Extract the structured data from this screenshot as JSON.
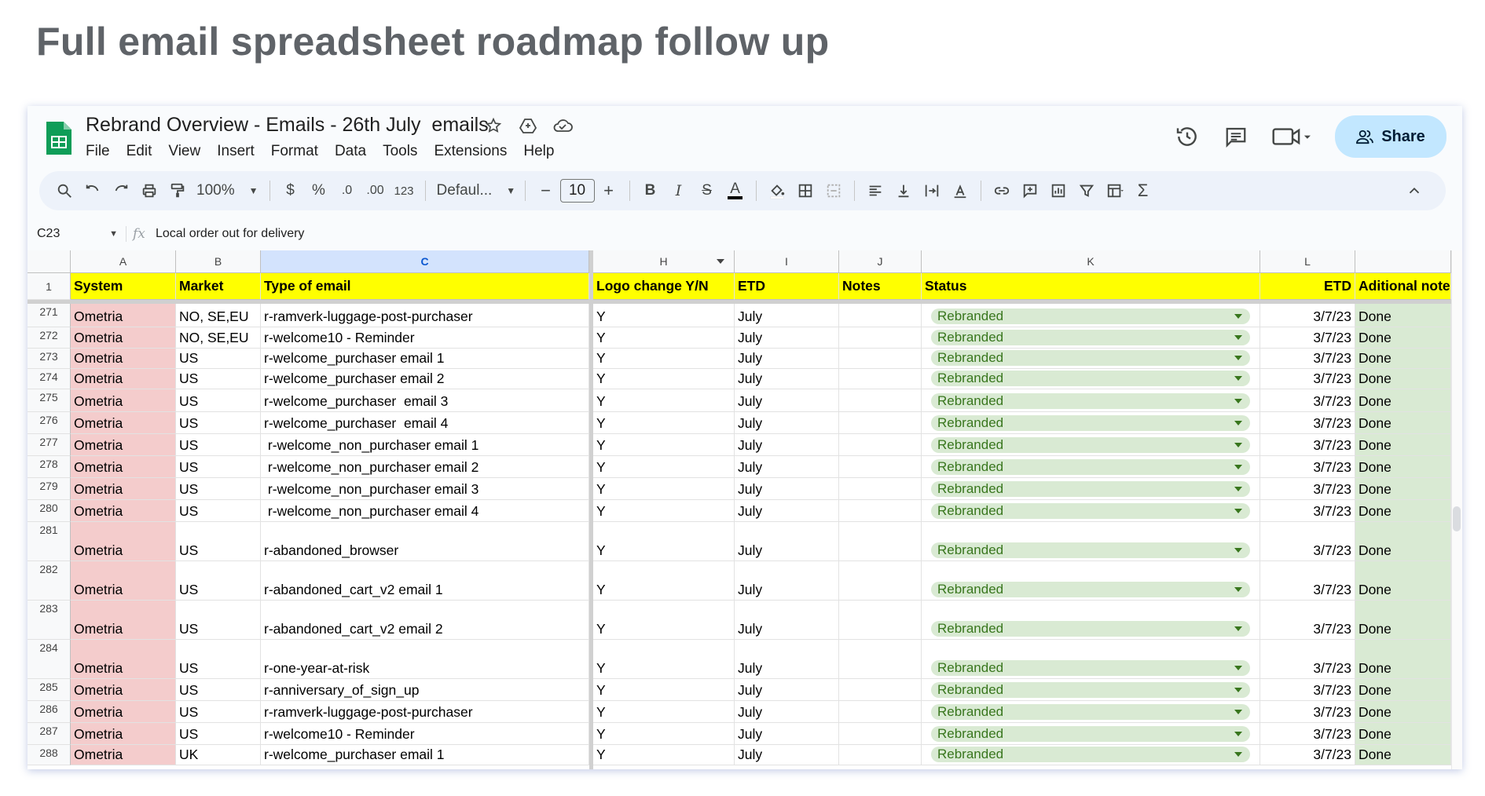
{
  "slide_title": "Full email spreadsheet roadmap follow up",
  "doc": {
    "title": "Rebrand Overview - Emails - 26th July  emails",
    "menu": [
      "File",
      "Edit",
      "View",
      "Insert",
      "Format",
      "Data",
      "Tools",
      "Extensions",
      "Help"
    ],
    "share_label": "Share"
  },
  "toolbar": {
    "zoom": "100%",
    "currency": "$",
    "percent": "%",
    "dec_decrease": ".0",
    "dec_increase": ".00",
    "number_format": "123",
    "font": "Defaul...",
    "font_size": "10"
  },
  "formula_bar": {
    "cell_ref": "C23",
    "fx": "fx",
    "content": "Local order out for delivery"
  },
  "columns": [
    "A",
    "B",
    "C",
    "H",
    "I",
    "J",
    "K",
    "L",
    ""
  ],
  "header_row": {
    "num": "1",
    "system": "System",
    "market": "Market",
    "type": "Type of email",
    "logo": "Logo change Y/N",
    "etd": "ETD",
    "notes": "Notes",
    "status": "Status",
    "etd2": "ETD",
    "additional": "Aditional note"
  },
  "rows": [
    {
      "num": "271",
      "system": "Ometria",
      "market": "NO, SE,EU",
      "type": "r-ramverk-luggage-post-purchaser",
      "logo": "Y",
      "etd": "July",
      "notes": "",
      "status": "Rebranded",
      "etd2": "3/7/23",
      "additional": "Done"
    },
    {
      "num": "272",
      "system": "Ometria",
      "market": "NO, SE,EU",
      "type": "r-welcome10 - Reminder",
      "logo": "Y",
      "etd": "July",
      "notes": "",
      "status": "Rebranded",
      "etd2": "3/7/23",
      "additional": "Done"
    },
    {
      "num": "273",
      "system": "Ometria",
      "market": "US",
      "type": "r-welcome_purchaser email 1",
      "logo": "Y",
      "etd": "July",
      "notes": "",
      "status": "Rebranded",
      "etd2": "3/7/23",
      "additional": "Done"
    },
    {
      "num": "274",
      "system": "Ometria",
      "market": "US",
      "type": "r-welcome_purchaser email 2",
      "logo": "Y",
      "etd": "July",
      "notes": "",
      "status": "Rebranded",
      "etd2": "3/7/23",
      "additional": "Done"
    },
    {
      "num": "275",
      "system": "Ometria",
      "market": "US",
      "type": "r-welcome_purchaser  email 3",
      "logo": "Y",
      "etd": "July",
      "notes": "",
      "status": "Rebranded",
      "etd2": "3/7/23",
      "additional": "Done"
    },
    {
      "num": "276",
      "system": "Ometria",
      "market": "US",
      "type": "r-welcome_purchaser  email 4",
      "logo": "Y",
      "etd": "July",
      "notes": "",
      "status": "Rebranded",
      "etd2": "3/7/23",
      "additional": "Done"
    },
    {
      "num": "277",
      "system": "Ometria",
      "market": "US",
      "type": " r-welcome_non_purchaser email 1",
      "logo": "Y",
      "etd": "July",
      "notes": "",
      "status": "Rebranded",
      "etd2": "3/7/23",
      "additional": "Done"
    },
    {
      "num": "278",
      "system": "Ometria",
      "market": "US",
      "type": " r-welcome_non_purchaser email 2",
      "logo": "Y",
      "etd": "July",
      "notes": "",
      "status": "Rebranded",
      "etd2": "3/7/23",
      "additional": "Done"
    },
    {
      "num": "279",
      "system": "Ometria",
      "market": "US",
      "type": " r-welcome_non_purchaser email 3",
      "logo": "Y",
      "etd": "July",
      "notes": "",
      "status": "Rebranded",
      "etd2": "3/7/23",
      "additional": "Done"
    },
    {
      "num": "280",
      "system": "Ometria",
      "market": "US",
      "type": " r-welcome_non_purchaser email 4",
      "logo": "Y",
      "etd": "July",
      "notes": "",
      "status": "Rebranded",
      "etd2": "3/7/23",
      "additional": "Done"
    },
    {
      "num": "281",
      "system": "Ometria",
      "market": "US",
      "type": "r-abandoned_browser",
      "logo": "Y",
      "etd": "July",
      "notes": "",
      "status": "Rebranded",
      "etd2": "3/7/23",
      "additional": "Done"
    },
    {
      "num": "282",
      "system": "Ometria",
      "market": "US",
      "type": "r-abandoned_cart_v2 email 1",
      "logo": "Y",
      "etd": "July",
      "notes": "",
      "status": "Rebranded",
      "etd2": "3/7/23",
      "additional": "Done"
    },
    {
      "num": "283",
      "system": "Ometria",
      "market": "US",
      "type": "r-abandoned_cart_v2 email 2",
      "logo": "Y",
      "etd": "July",
      "notes": "",
      "status": "Rebranded",
      "etd2": "3/7/23",
      "additional": "Done"
    },
    {
      "num": "284",
      "system": "Ometria",
      "market": "US",
      "type": "r-one-year-at-risk",
      "logo": "Y",
      "etd": "July",
      "notes": "",
      "status": "Rebranded",
      "etd2": "3/7/23",
      "additional": "Done"
    },
    {
      "num": "285",
      "system": "Ometria",
      "market": "US",
      "type": "r-anniversary_of_sign_up",
      "logo": "Y",
      "etd": "July",
      "notes": "",
      "status": "Rebranded",
      "etd2": "3/7/23",
      "additional": "Done"
    },
    {
      "num": "286",
      "system": "Ometria",
      "market": "US",
      "type": "r-ramverk-luggage-post-purchaser",
      "logo": "Y",
      "etd": "July",
      "notes": "",
      "status": "Rebranded",
      "etd2": "3/7/23",
      "additional": "Done"
    },
    {
      "num": "287",
      "system": "Ometria",
      "market": "US",
      "type": "r-welcome10 - Reminder",
      "logo": "Y",
      "etd": "July",
      "notes": "",
      "status": "Rebranded",
      "etd2": "3/7/23",
      "additional": "Done"
    },
    {
      "num": "288",
      "system": "Ometria",
      "market": "UK",
      "type": "r-welcome_purchaser email 1",
      "logo": "Y",
      "etd": "July",
      "notes": "",
      "status": "Rebranded",
      "etd2": "3/7/23",
      "additional": "Done"
    }
  ],
  "colors": {
    "header_yellow": "#ffff00",
    "system_pink": "#f4cccc",
    "notes_green": "#d9ead3",
    "chip_text": "#38761d",
    "share_bg": "#c2e7ff",
    "sheets_green": "#0f9d58"
  },
  "icons": [
    "search-icon",
    "undo-icon",
    "redo-icon",
    "print-icon",
    "paint-format-icon",
    "bold-icon",
    "italic-icon",
    "strikethrough-icon",
    "text-color-icon",
    "fill-color-icon",
    "borders-icon",
    "merge-icon",
    "align-icon",
    "valign-icon",
    "wrap-icon",
    "rotate-icon",
    "link-icon",
    "comment-icon",
    "chart-icon",
    "filter-icon",
    "table-icon",
    "functions-icon",
    "collapse-icon",
    "history-icon",
    "chat-icon",
    "meet-icon",
    "star-icon",
    "move-icon",
    "cloud-icon"
  ]
}
